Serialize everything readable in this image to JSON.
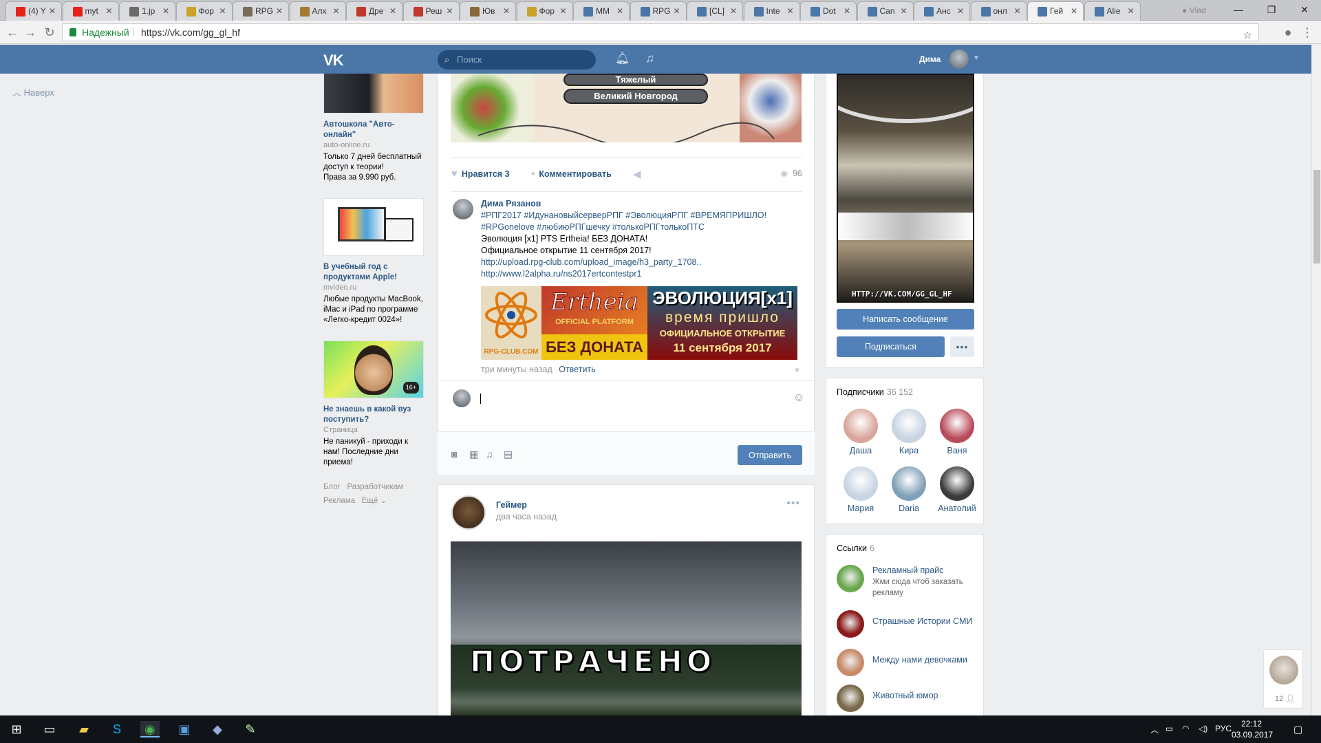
{
  "browser": {
    "tabs": [
      {
        "label": "(4) Y",
        "color": "#e62117"
      },
      {
        "label": "myt",
        "color": "#e62117"
      },
      {
        "label": "1.jp",
        "color": "#6b6b6b"
      },
      {
        "label": "Фор",
        "color": "#c9a227"
      },
      {
        "label": "RPG",
        "color": "#7a6a5a"
      },
      {
        "label": "Алх",
        "color": "#a07b32"
      },
      {
        "label": "Дре",
        "color": "#c0392b"
      },
      {
        "label": "Реш",
        "color": "#c0392b"
      },
      {
        "label": "Юв",
        "color": "#8a6a3a"
      },
      {
        "label": "Фор",
        "color": "#c9a227"
      },
      {
        "label": "MM",
        "color": "#4a76a8"
      },
      {
        "label": "RPG",
        "color": "#4a76a8"
      },
      {
        "label": "[CL]",
        "color": "#4a76a8"
      },
      {
        "label": "Inte",
        "color": "#4a76a8"
      },
      {
        "label": "Dot",
        "color": "#4a76a8"
      },
      {
        "label": "Can",
        "color": "#4a76a8"
      },
      {
        "label": "Анс",
        "color": "#4a76a8"
      },
      {
        "label": "онл",
        "color": "#4a76a8"
      },
      {
        "label": "Гей",
        "color": "#4a76a8",
        "active": true
      },
      {
        "label": "Alie",
        "color": "#4a76a8"
      }
    ],
    "profile_label": "Vlad",
    "secure_label": "Надежный",
    "url": "https://vk.com/gg_gl_hf"
  },
  "vk_header": {
    "logo": "VK",
    "search_placeholder": "Поиск",
    "user_name": "Дима"
  },
  "left_nav": {
    "back_to_top": "Наверх"
  },
  "ads": [
    {
      "title": "Автошкола \"Авто-онлайн\"",
      "domain": "auto-online.ru",
      "text": "Только 7 дней бесплатный доступ к теории!\nПрава за 9.990 руб."
    },
    {
      "title": "В учебный год с продуктами Apple!",
      "domain": "mvideo.ru",
      "text": "Любые продукты MacBook, iMac и iPad по программе «Легко-кредит 0024»!"
    },
    {
      "title": "Не знаешь в какой вуз поступить?",
      "domain": "Страница",
      "text": "Не паникуй - приходи к нам! Последние дни приема!",
      "badge": "16+"
    }
  ],
  "ads_footer": {
    "blog": "Блог",
    "devs": "Разработчикам",
    "ads": "Реклама",
    "more": "Ещё"
  },
  "post1": {
    "banner_city1": "Тяжелый",
    "banner_city2": "Великий Новгород",
    "like_label": "Нравится",
    "like_count": "3",
    "comment_label": "Комментировать",
    "views": "96"
  },
  "comment": {
    "author": "Дима Рязанов",
    "hashtags": "#РПГ2017 #ИдунановыйсерверРПГ #ЭволюцияРПГ #ВРЕМЯПРИШЛО! #RPGonelove #любиюРПГшечку #толькоРПГтолькоПТС",
    "line1": "Эволюция [x1] PTS Ertheia! БЕЗ ДОНАТА!",
    "line2": "Официальное открытие 11 сентября 2017!",
    "link1": "http://upload.rpg-club.com/upload_image/h3_party_1708..",
    "link2": "http://www.l2alpha.ru/ns2017ertcontestpr1",
    "banner": {
      "club": "RPG-CLUB.COM",
      "game": "Ertheia",
      "platform": "OFFICIAL PLATFORM",
      "no_donate": "БЕЗ ДОНАТА",
      "evolution": "ЭВОЛЮЦИЯ[x1]",
      "time_came": "время пришло",
      "opening": "ОФИЦИАЛЬНОЕ ОТКРЫТИЕ",
      "date": "11 сентября 2017"
    },
    "time": "три минуты назад",
    "reply_label": "Ответить"
  },
  "reply_form": {
    "send_label": "Отправить"
  },
  "post2": {
    "author": "Геймер",
    "time": "два часа назад",
    "image_caption": "ПОТРАЧЕНО"
  },
  "group": {
    "cover_url": "HTTP://VK.COM/GG_GL_HF",
    "message_button": "Написать сообщение",
    "subscribe_button": "Подписаться"
  },
  "members": {
    "title": "Подписчики",
    "count": "36 152",
    "list": [
      {
        "name": "Даша",
        "color": "#d9a59a"
      },
      {
        "name": "Кира",
        "color": "#c8d4e2"
      },
      {
        "name": "Ваня",
        "color": "#b84a5a"
      },
      {
        "name": "Мария",
        "color": "#c8d4e2"
      },
      {
        "name": "Daria",
        "color": "#7fa0b8"
      },
      {
        "name": "Анатолий",
        "color": "#3a3a3a"
      }
    ]
  },
  "links": {
    "title": "Ссылки",
    "count": "6",
    "list": [
      {
        "title": "Рекламный прайс",
        "desc": "Жми сюда чтоб заказать рекламу",
        "color": "#6aa84f"
      },
      {
        "title": "Страшные Истории СМИ",
        "desc": "",
        "color": "#8b1a1a"
      },
      {
        "title": "Между нами девочками",
        "desc": "",
        "color": "#c98a6a"
      },
      {
        "title": "Животный юмор",
        "desc": "",
        "color": "#7a6a4a"
      }
    ]
  },
  "chat": {
    "count": "12"
  },
  "taskbar": {
    "lang": "РУС",
    "time": "22:12",
    "date": "03.09.2017"
  }
}
